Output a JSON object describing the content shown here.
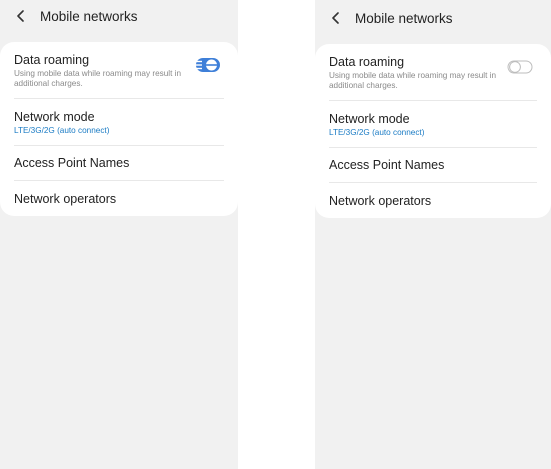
{
  "screens": [
    {
      "header": {
        "title": "Mobile networks",
        "back_icon": "chevron-left-icon"
      },
      "items": {
        "data_roaming": {
          "label": "Data roaming",
          "description": "Using mobile data while roaming may result in additional charges.",
          "toggle_state": "on"
        },
        "network_mode": {
          "label": "Network mode",
          "value": "LTE/3G/2G (auto connect)"
        },
        "access_point_names": {
          "label": "Access Point Names"
        },
        "network_operators": {
          "label": "Network operators"
        }
      }
    },
    {
      "header": {
        "title": "Mobile networks",
        "back_icon": "chevron-left-icon"
      },
      "items": {
        "data_roaming": {
          "label": "Data roaming",
          "description": "Using mobile data while roaming may result in additional charges.",
          "toggle_state": "off"
        },
        "network_mode": {
          "label": "Network mode",
          "value": "LTE/3G/2G (auto connect)"
        },
        "access_point_names": {
          "label": "Access Point Names"
        },
        "network_operators": {
          "label": "Network operators"
        }
      }
    }
  ],
  "colors": {
    "background": "#f1f1f1",
    "card": "#ffffff",
    "accent": "#1a7bc4",
    "toggle_on": "#3e7fd8",
    "toggle_off": "#bdbdbd"
  }
}
